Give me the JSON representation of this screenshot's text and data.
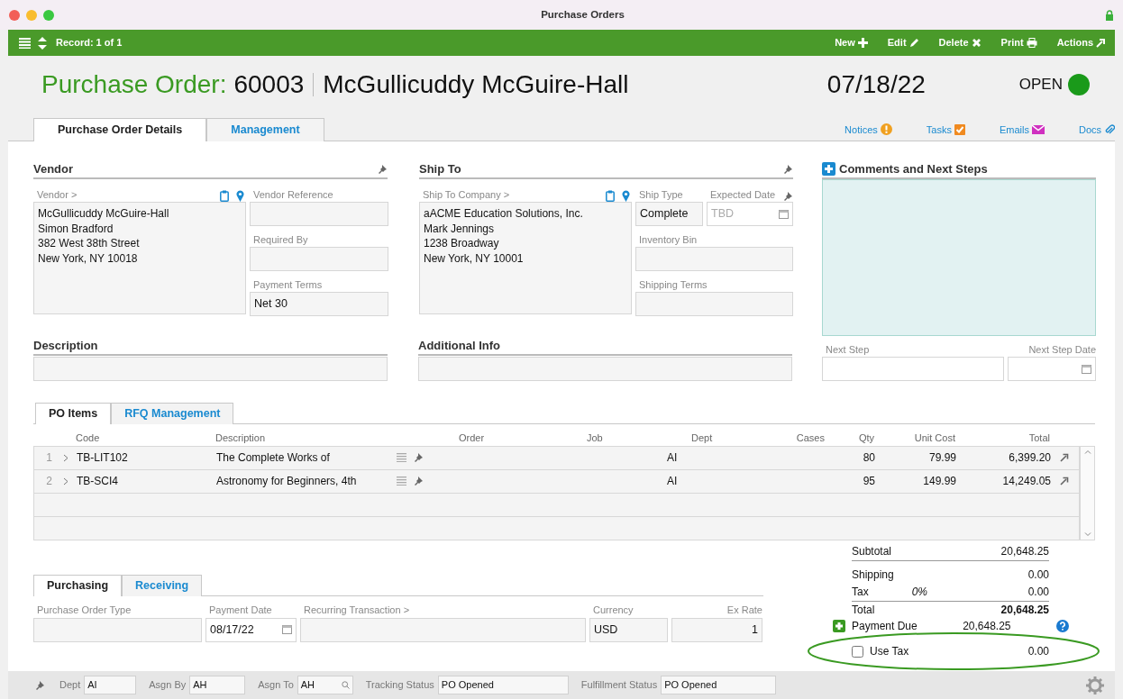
{
  "window": {
    "title": "Purchase Orders"
  },
  "toolbar": {
    "record": "Record: 1 of 1",
    "actions": [
      {
        "label": "New"
      },
      {
        "label": "Edit"
      },
      {
        "label": "Delete"
      },
      {
        "label": "Print"
      },
      {
        "label": "Actions"
      }
    ]
  },
  "header": {
    "label": "Purchase Order:",
    "number": "60003",
    "vendor": "McGullicuddy McGuire-Hall",
    "date": "07/18/22",
    "status": "OPEN"
  },
  "tabs": [
    {
      "label": "Purchase Order Details",
      "selected": true
    },
    {
      "label": "Management",
      "selected": false
    }
  ],
  "links": [
    {
      "label": "Notices"
    },
    {
      "label": "Tasks"
    },
    {
      "label": "Emails"
    },
    {
      "label": "Docs"
    }
  ],
  "vendor": {
    "title": "Vendor",
    "address_label": "Vendor >",
    "address": [
      "McGullicuddy McGuire-Hall",
      "Simon Bradford",
      "382 West 38th Street",
      "New York, NY 10018"
    ],
    "fields": [
      {
        "label": "Vendor Reference"
      },
      {
        "label": "Required By"
      },
      {
        "label": "Payment Terms",
        "value": "Net 30"
      }
    ]
  },
  "ship_to": {
    "title": "Ship To",
    "address_label": "Ship To Company >",
    "address": [
      "aACME Education Solutions, Inc.",
      "Mark Jennings",
      "1238 Broadway",
      "New York, NY 10001"
    ],
    "ship_type": {
      "label": "Ship Type",
      "value": "Complete"
    },
    "expected_date": {
      "label": "Expected Date",
      "placeholder": "TBD"
    },
    "fields": [
      {
        "label": "Inventory Bin"
      },
      {
        "label": "Shipping Terms"
      }
    ]
  },
  "comments": {
    "title": "Comments and Next Steps",
    "next_step": {
      "label": "Next Step"
    },
    "next_step_date": {
      "label": "Next Step Date"
    }
  },
  "description": {
    "title": "Description"
  },
  "additional_info": {
    "title": "Additional Info"
  },
  "item_tabs": [
    {
      "label": "PO Items",
      "selected": true
    },
    {
      "label": "RFQ Management",
      "selected": false
    }
  ],
  "items": {
    "columns": [
      "Code",
      "Description",
      "Order",
      "Job",
      "Dept",
      "Cases",
      "Qty",
      "Unit Cost",
      "Total"
    ],
    "rows": [
      {
        "number": "1",
        "code": "TB-LIT102",
        "description": "The Complete Works of",
        "dept": "AI",
        "qty": "80",
        "unit_cost": "79.99",
        "total": "6,399.20"
      },
      {
        "number": "2",
        "code": "TB-SCI4",
        "description": "Astronomy for Beginners, 4th",
        "dept": "AI",
        "qty": "95",
        "unit_cost": "149.99",
        "total": "14,249.05"
      }
    ]
  },
  "bottom_tabs": [
    {
      "label": "Purchasing",
      "selected": true
    },
    {
      "label": "Receiving",
      "selected": false
    }
  ],
  "purchasing": [
    {
      "label": "Purchase Order Type",
      "kind": "text"
    },
    {
      "label": "Payment Date",
      "value": "08/17/22",
      "kind": "date"
    },
    {
      "label": "Recurring Transaction >",
      "kind": "text"
    },
    {
      "label": "Currency",
      "value": "USD",
      "kind": "text"
    },
    {
      "label": "Ex Rate",
      "value": "1",
      "kind": "number"
    }
  ],
  "totals": [
    {
      "label": "Subtotal",
      "value": "20,648.25",
      "kind": "line"
    },
    {
      "label": "Shipping",
      "value": "0.00",
      "kind": "line"
    },
    {
      "label": "Tax",
      "rate": "0%",
      "value": "0.00",
      "kind": "line"
    },
    {
      "label": "Total",
      "value": "20,648.25",
      "kind": "total"
    },
    {
      "label": "Payment Due",
      "value": "20,648.25",
      "kind": "payment"
    },
    {
      "label": "Use Tax",
      "value": "0.00",
      "kind": "checkbox",
      "checked": false
    }
  ],
  "status_bar": [
    {
      "label": "Dept",
      "value": "AI",
      "kind": "text"
    },
    {
      "label": "Asgn By",
      "value": "AH",
      "kind": "text"
    },
    {
      "label": "Asgn To",
      "value": "AH",
      "kind": "lookup"
    },
    {
      "label": "Tracking Status",
      "value": "PO Opened",
      "kind": "text"
    },
    {
      "label": "Fulfillment Status",
      "value": "PO Opened",
      "kind": "text"
    }
  ]
}
